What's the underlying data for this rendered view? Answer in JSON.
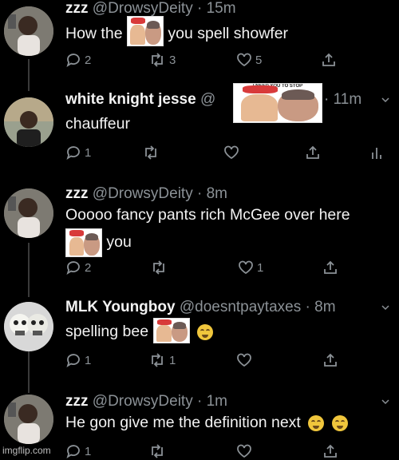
{
  "tweets": [
    {
      "name": "zzz",
      "handle": "@DrowsyDeity",
      "time": "· 15m",
      "text_before": "How the",
      "text_after": "you spell showfer",
      "replies": "2",
      "retweets": "3",
      "likes": "5"
    },
    {
      "name": "white knight jesse",
      "handle": "@",
      "time": "· 11m",
      "text": "chauffeur",
      "replies": "1",
      "retweets": "",
      "likes": ""
    },
    {
      "name": "zzz",
      "handle": "@DrowsyDeity",
      "time": "· 8m",
      "text": "Ooooo fancy pants rich McGee over here",
      "text2": "you",
      "replies": "2",
      "retweets": "",
      "likes": "1"
    },
    {
      "name": "MLK Youngboy",
      "handle": "@doesntpaytaxes",
      "time": "· 8m",
      "text": "spelling bee",
      "replies": "1",
      "retweets": "1",
      "likes": ""
    },
    {
      "name": "zzz",
      "handle": "@DrowsyDeity",
      "time": "· 1m",
      "text": "He gon give me the definition next",
      "replies": "1",
      "retweets": "",
      "likes": ""
    }
  ],
  "meme_caption": "I NEED YOU TO STOP",
  "watermark": "imgflip.com",
  "colors": {
    "background": "#000000",
    "text": "#f2f2f2",
    "muted": "#8b9196",
    "thread_line": "#3a3a3a"
  },
  "icons": [
    "reply-icon",
    "retweet-icon",
    "like-icon",
    "share-icon",
    "analytics-icon",
    "chevron-down-icon",
    "crying-laughing-emoji"
  ]
}
